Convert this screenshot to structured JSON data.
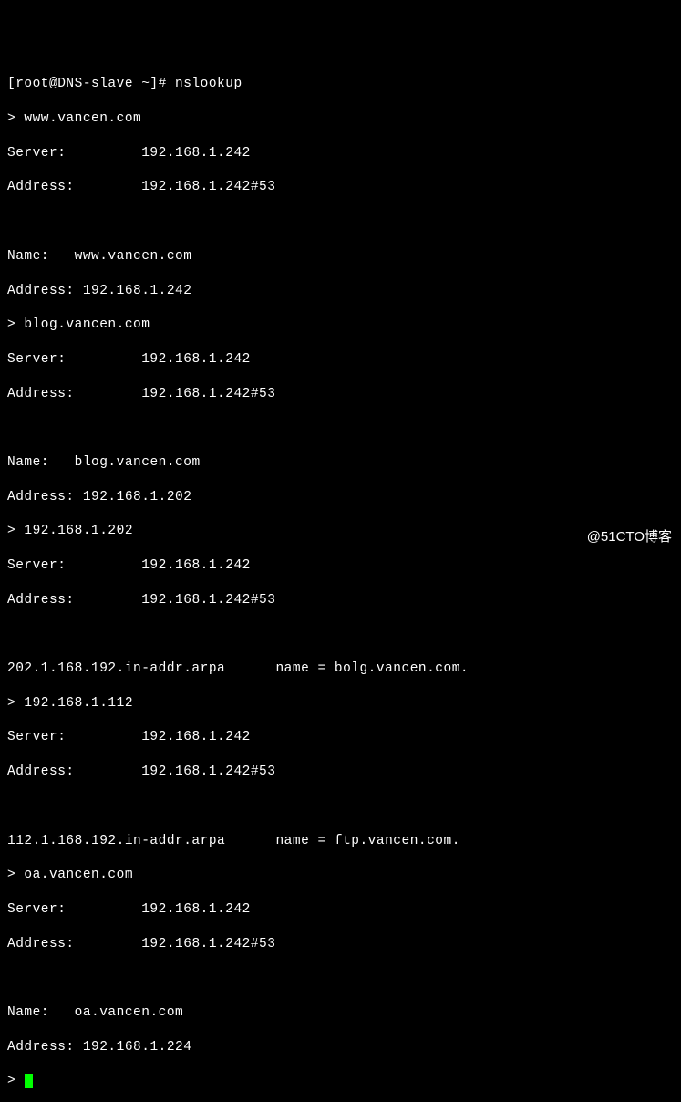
{
  "prompt": "[root@DNS-slave ~]# ",
  "command": "nslookup",
  "queries": [
    {
      "input": "www.vancen.com",
      "server": "192.168.1.242",
      "address": "192.168.1.242#53",
      "result_name_label": "Name:   ",
      "result_name": "www.vancen.com",
      "result_address_label": "Address: ",
      "result_address": "192.168.1.242"
    },
    {
      "input": "blog.vancen.com",
      "server": "192.168.1.242",
      "address": "192.168.1.242#53",
      "result_name_label": "Name:   ",
      "result_name": "blog.vancen.com",
      "result_address_label": "Address: ",
      "result_address": "192.168.1.202"
    },
    {
      "input": "192.168.1.202",
      "server": "192.168.1.242",
      "address": "192.168.1.242#53",
      "ptr_query": "202.1.168.192.in-addr.arpa",
      "ptr_result": "name = bolg.vancen.com."
    },
    {
      "input": "192.168.1.112",
      "server": "192.168.1.242",
      "address": "192.168.1.242#53",
      "ptr_query": "112.1.168.192.in-addr.arpa",
      "ptr_result": "name = ftp.vancen.com."
    },
    {
      "input": "oa.vancen.com",
      "server": "192.168.1.242",
      "address": "192.168.1.242#53",
      "result_name_label": "Name:   ",
      "result_name": "oa.vancen.com",
      "result_address_label": "Address: ",
      "result_address": "192.168.1.224"
    }
  ],
  "labels": {
    "server": "Server:         ",
    "address": "Address:        ",
    "query_prompt": "> "
  },
  "watermark": "@51CTO博客"
}
